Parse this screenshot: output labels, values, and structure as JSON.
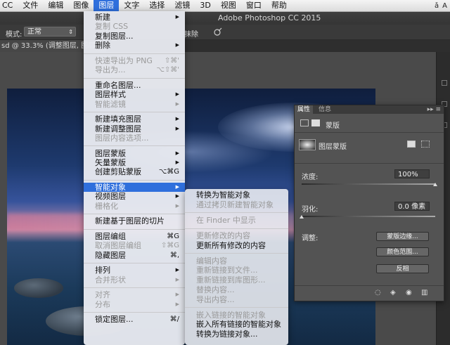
{
  "menubar": {
    "items": [
      "CC",
      "文件",
      "编辑",
      "图像",
      "图层",
      "文字",
      "选择",
      "滤镜",
      "3D",
      "视图",
      "窗口",
      "帮助"
    ],
    "active_index": 4,
    "tray": [
      "ǎ",
      "A"
    ]
  },
  "window": {
    "title": "Adobe Photoshop CC 2015"
  },
  "options": {
    "mode_label": "模式:",
    "mode_value": "正常",
    "erase_label": "抹除"
  },
  "document": {
    "tab": "sd @ 33.3% (调整图层, 图层蒙"
  },
  "layer_menu": {
    "items": [
      {
        "label": "新建",
        "sub": true,
        "disabled": false
      },
      {
        "label": "复制 CSS",
        "disabled": true
      },
      {
        "label": "复制图层...",
        "disabled": false
      },
      {
        "label": "删除",
        "sub": true,
        "disabled": false
      },
      {
        "sep": true
      },
      {
        "label": "快速导出为 PNG",
        "shortcut": "⇧⌘'",
        "disabled": true
      },
      {
        "label": "导出为...",
        "shortcut": "⌥⇧⌘'",
        "disabled": true
      },
      {
        "sep": true
      },
      {
        "label": "重命名图层...",
        "disabled": false
      },
      {
        "label": "图层样式",
        "sub": true,
        "disabled": false
      },
      {
        "label": "智能滤镜",
        "sub": true,
        "disabled": true
      },
      {
        "sep": true
      },
      {
        "label": "新建填充图层",
        "sub": true,
        "disabled": false
      },
      {
        "label": "新建调整图层",
        "sub": true,
        "disabled": false
      },
      {
        "label": "图层内容选项...",
        "disabled": true
      },
      {
        "sep": true
      },
      {
        "label": "图层蒙版",
        "sub": true,
        "disabled": false
      },
      {
        "label": "矢量蒙版",
        "sub": true,
        "disabled": false
      },
      {
        "label": "创建剪贴蒙版",
        "shortcut": "⌥⌘G",
        "disabled": false
      },
      {
        "sep": true
      },
      {
        "label": "智能对象",
        "sub": true,
        "highlight": true,
        "disabled": false
      },
      {
        "label": "视频图层",
        "sub": true,
        "disabled": false
      },
      {
        "label": "栅格化",
        "sub": true,
        "disabled": true
      },
      {
        "sep": true
      },
      {
        "label": "新建基于图层的切片",
        "disabled": false
      },
      {
        "sep": true
      },
      {
        "label": "图层编组",
        "shortcut": "⌘G",
        "disabled": false
      },
      {
        "label": "取消图层编组",
        "shortcut": "⇧⌘G",
        "disabled": true
      },
      {
        "label": "隐藏图层",
        "shortcut": "⌘,",
        "disabled": false
      },
      {
        "sep": true
      },
      {
        "label": "排列",
        "sub": true,
        "disabled": false
      },
      {
        "label": "合并形状",
        "sub": true,
        "disabled": true
      },
      {
        "sep": true
      },
      {
        "label": "对齐",
        "sub": true,
        "disabled": true
      },
      {
        "label": "分布",
        "sub": true,
        "disabled": true
      },
      {
        "sep": true
      },
      {
        "label": "锁定图层...",
        "shortcut": "⌘/",
        "disabled": false
      }
    ]
  },
  "smart_menu": {
    "items": [
      {
        "label": "转换为智能对象",
        "disabled": false
      },
      {
        "label": "通过拷贝新建智能对象",
        "disabled": true
      },
      {
        "sep": true
      },
      {
        "label": "在 Finder 中显示",
        "disabled": true
      },
      {
        "sep": true
      },
      {
        "label": "更新修改的内容",
        "disabled": true
      },
      {
        "label": "更新所有修改的内容",
        "disabled": false
      },
      {
        "sep": true
      },
      {
        "label": "编辑内容",
        "disabled": true
      },
      {
        "label": "重新链接到文件...",
        "disabled": true
      },
      {
        "label": "重新链接到库图形...",
        "disabled": true
      },
      {
        "label": "替换内容...",
        "disabled": true
      },
      {
        "label": "导出内容...",
        "disabled": true
      },
      {
        "sep": true
      },
      {
        "label": "嵌入链接的智能对象",
        "disabled": true
      },
      {
        "label": "嵌入所有链接的智能对象",
        "disabled": false
      },
      {
        "label": "转换为链接对象...",
        "disabled": false
      }
    ]
  },
  "properties": {
    "tabs": [
      "属性",
      "信息"
    ],
    "menu_icon": "▸▸ ≡",
    "section_label": "蒙版",
    "mask_label": "图层蒙版",
    "density_label": "浓度:",
    "density_value": "100%",
    "density": 1.0,
    "feather_label": "羽化:",
    "feather_value": "0.0 像素",
    "feather": 0.0,
    "adjust_label": "调整:",
    "buttons": [
      "蒙版边缘...",
      "颜色范围...",
      "反相"
    ]
  },
  "colors": {
    "menu_highlight": "#2f6fdc",
    "panel_bg": "#535353"
  }
}
